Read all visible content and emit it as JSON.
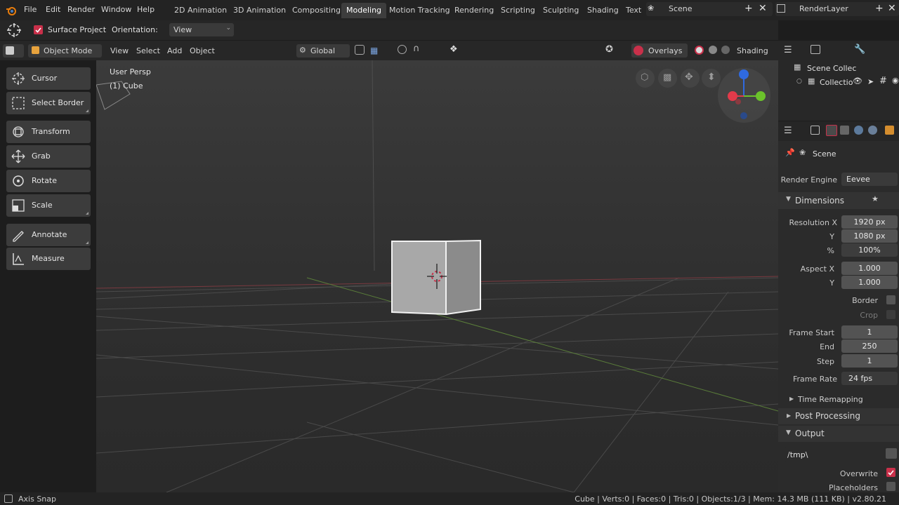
{
  "topbar": {
    "menus": [
      "File",
      "Edit",
      "Render",
      "Window",
      "Help"
    ],
    "workspaces": [
      "2D Animation",
      "3D Animation",
      "Compositing",
      "Modeling",
      "Motion Tracking",
      "Rendering",
      "Scripting",
      "Sculpting",
      "Shading",
      "Text"
    ],
    "active_workspace": "Modeling",
    "scene": "Scene",
    "view_layer": "RenderLayer"
  },
  "toolsettings": {
    "surface_project": "Surface Project",
    "orientation_label": "Orientation:",
    "orientation_value": "View"
  },
  "header": {
    "mode": "Object Mode",
    "menus": [
      "View",
      "Select",
      "Add",
      "Object"
    ],
    "transform_orientation": "Global",
    "overlays": "Overlays",
    "shading": "Shading"
  },
  "viewport": {
    "view_name": "User Persp",
    "object_name": "(1) Cube"
  },
  "toolbar": {
    "tools": [
      "Cursor",
      "Select Border",
      "Transform",
      "Grab",
      "Rotate",
      "Scale",
      "Annotate",
      "Measure"
    ]
  },
  "outliner": {
    "scene_collection": "Scene Collec",
    "collection": "Collectio"
  },
  "properties": {
    "context": "Scene",
    "render_engine_label": "Render Engine",
    "render_engine": "Eevee",
    "dimensions": "Dimensions",
    "resolution_x_label": "Resolution X",
    "resolution_x": "1920 px",
    "resolution_y_label": "Y",
    "resolution_y": "1080 px",
    "percent_label": "%",
    "percent": "100%",
    "aspect_x_label": "Aspect X",
    "aspect_x": "1.000",
    "aspect_y_label": "Y",
    "aspect_y": "1.000",
    "border_label": "Border",
    "crop_label": "Crop",
    "frame_start_label": "Frame Start",
    "frame_start": "1",
    "end_label": "End",
    "end": "250",
    "step_label": "Step",
    "step": "1",
    "frame_rate_label": "Frame Rate",
    "frame_rate": "24 fps",
    "time_remapping": "Time Remapping",
    "post_processing": "Post Processing",
    "output": "Output",
    "output_path": "/tmp\\",
    "overwrite_label": "Overwrite",
    "placeholders_label": "Placeholders"
  },
  "status": {
    "left": "Axis Snap",
    "right": "Cube | Verts:0 | Faces:0 | Tris:0 | Objects:1/3 | Mem: 14.3 MB (111 KB) | v2.80.21"
  },
  "colors": {
    "accent_checkbox": "#c9304a",
    "axis_x": "#e23a4a",
    "axis_y": "#6bc22b",
    "axis_z": "#2f6ae0"
  }
}
